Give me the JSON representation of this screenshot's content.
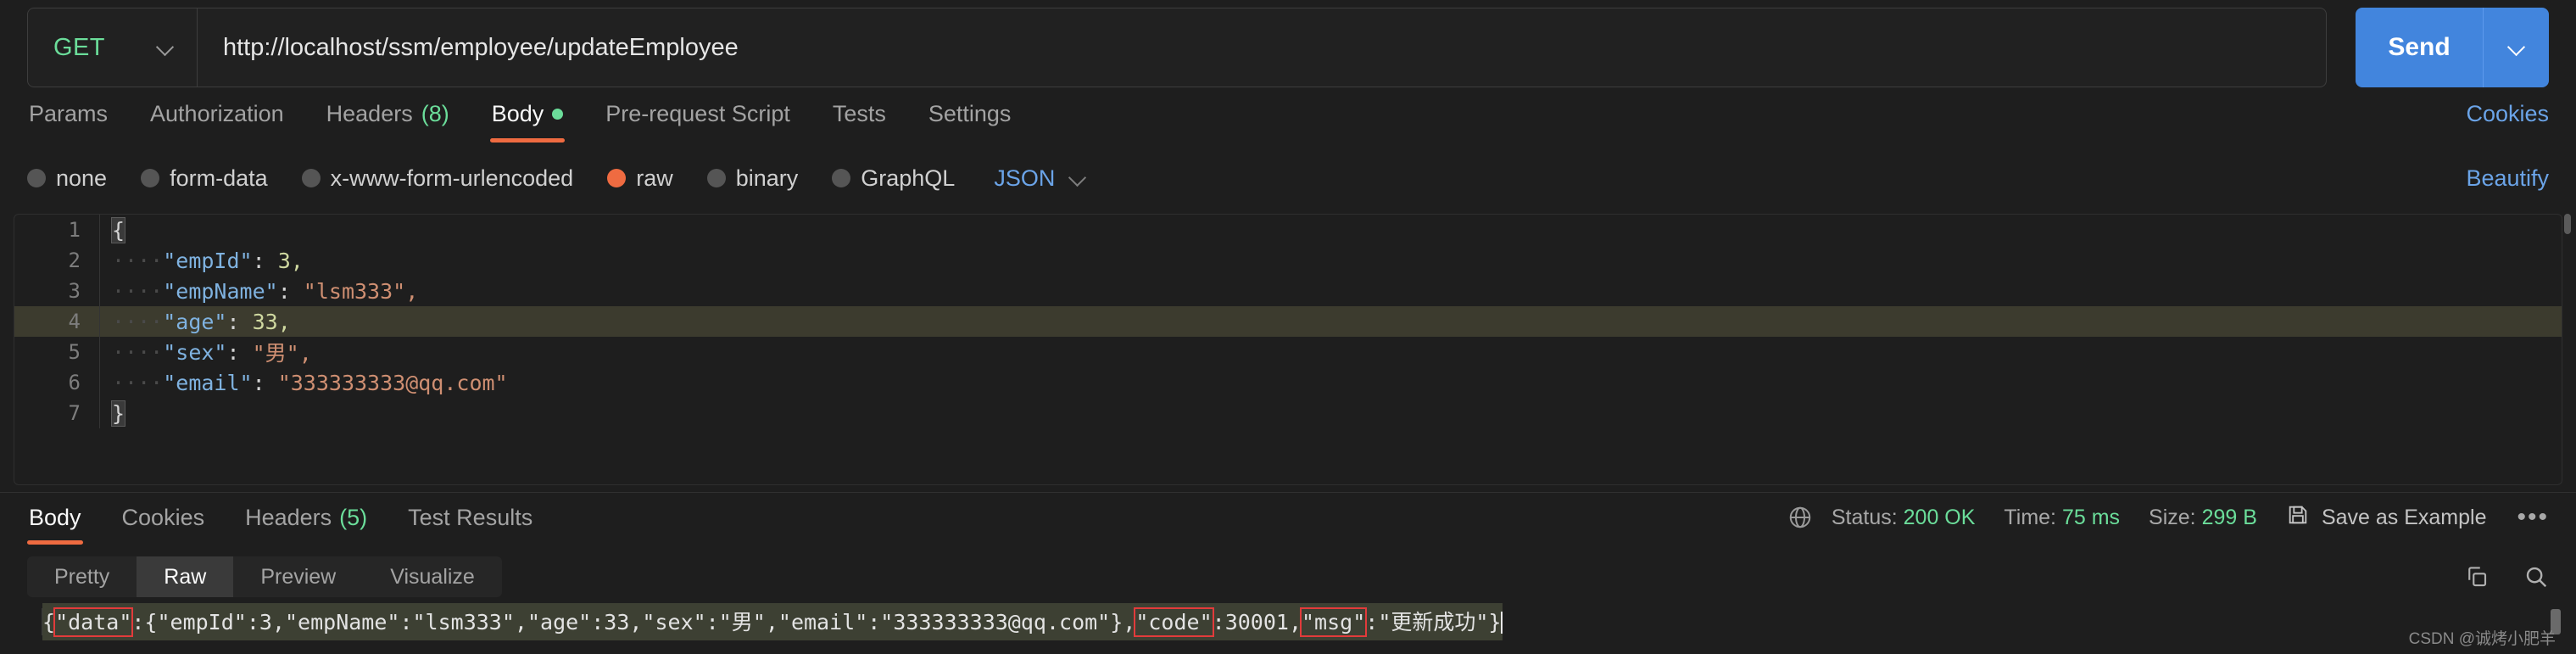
{
  "request": {
    "method": "GET",
    "url": "http://localhost/ssm/employee/updateEmployee",
    "send_label": "Send",
    "tabs": [
      {
        "label": "Params",
        "active": false
      },
      {
        "label": "Authorization",
        "active": false
      },
      {
        "label": "Headers",
        "count": "(8)",
        "active": false
      },
      {
        "label": "Body",
        "active": true,
        "dot": true
      },
      {
        "label": "Pre-request Script",
        "active": false
      },
      {
        "label": "Tests",
        "active": false
      },
      {
        "label": "Settings",
        "active": false
      }
    ],
    "cookies_link": "Cookies",
    "body_types": [
      {
        "label": "none",
        "selected": false
      },
      {
        "label": "form-data",
        "selected": false
      },
      {
        "label": "x-www-form-urlencoded",
        "selected": false
      },
      {
        "label": "raw",
        "selected": true
      },
      {
        "label": "binary",
        "selected": false
      },
      {
        "label": "GraphQL",
        "selected": false
      }
    ],
    "format_select": "JSON",
    "beautify_label": "Beautify"
  },
  "editor": {
    "lines": [
      {
        "num": "1",
        "highlight": false
      },
      {
        "num": "2",
        "highlight": false
      },
      {
        "num": "3",
        "highlight": false
      },
      {
        "num": "4",
        "highlight": true
      },
      {
        "num": "5",
        "highlight": false
      },
      {
        "num": "6",
        "highlight": false
      },
      {
        "num": "7",
        "highlight": false
      }
    ],
    "json": {
      "empId": "3",
      "empName": "lsm333",
      "age": "33",
      "sex": "男",
      "email": "333333333@qq.com"
    },
    "tokens": {
      "open_brace": "{",
      "close_brace": "}",
      "indent": "····",
      "colon": ": ",
      "comma": ",",
      "k_empId": "\"empId\"",
      "k_empName": "\"empName\"",
      "k_age": "\"age\"",
      "k_sex": "\"sex\"",
      "k_email": "\"email\"",
      "v_empId": "3,",
      "v_empName": "\"lsm333\",",
      "v_age": "33,",
      "v_sex": "\"男\",",
      "v_email": "\"333333333@qq.com\""
    }
  },
  "response": {
    "tabs": [
      {
        "label": "Body",
        "active": true
      },
      {
        "label": "Cookies",
        "active": false
      },
      {
        "label": "Headers",
        "count": "(5)",
        "active": false
      },
      {
        "label": "Test Results",
        "active": false
      }
    ],
    "status_label": "Status:",
    "status_value": "200 OK",
    "time_label": "Time:",
    "time_value": "75 ms",
    "size_label": "Size:",
    "size_value": "299 B",
    "save_example": "Save as Example",
    "more_dots": "•••",
    "view_tabs": [
      {
        "label": "Pretty",
        "active": false
      },
      {
        "label": "Raw",
        "active": true
      },
      {
        "label": "Preview",
        "active": false
      },
      {
        "label": "Visualize",
        "active": false
      }
    ],
    "raw": {
      "seg1": "{",
      "hl_data": "\"data\"",
      "seg2": ":{\"empId\":3,\"empName\":\"lsm333\",\"age\":33,\"sex\":\"男\",\"email\":\"333333333@qq.com\"},",
      "hl_code": "\"code\"",
      "seg3": ":30001,",
      "hl_msg": "\"msg\"",
      "seg4": ":\"更新成功\"}"
    }
  },
  "watermark": "CSDN @诚烤小肥羊",
  "colors": {
    "accent_orange": "#ef6b41",
    "send_blue": "#4285dd",
    "link_blue": "#6ba4e8",
    "success_green": "#6bdd9a",
    "annotation_red": "#e23b3b",
    "background": "#1e1e1e"
  }
}
